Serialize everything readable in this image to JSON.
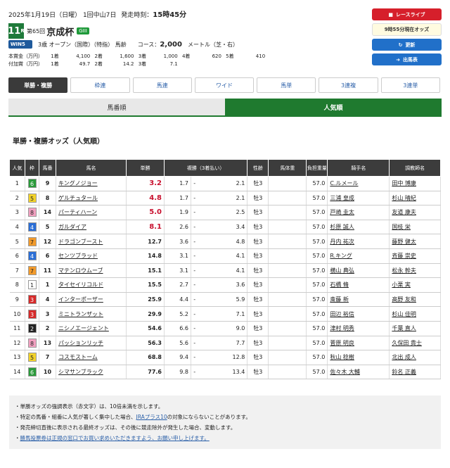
{
  "header": {
    "date": "2025年1月19日（日曜） 1回中山7日",
    "start_label": "発走時刻：",
    "start_time": "15時45分",
    "race_no": "11",
    "race_no_suffix": "R",
    "race_count": "第65回",
    "race_name": "京成杯",
    "grade": "GIII",
    "win5_label": "WIN5",
    "win5_num": "5",
    "conditions": "3歳 オープン（国際）（特指） 馬齢",
    "course_label": "コース：",
    "distance": "2,000",
    "distance_unit": "メートル（芝・右）"
  },
  "prize": {
    "main_label": "本賞金（万円）",
    "main": [
      [
        "1着",
        "4,100"
      ],
      [
        "2着",
        "1,600"
      ],
      [
        "3着",
        "1,000"
      ],
      [
        "4着",
        "620"
      ],
      [
        "5着",
        "410"
      ]
    ],
    "add_label": "付加賞（万円）",
    "add": [
      [
        "1着",
        "49.7"
      ],
      [
        "2着",
        "14.2"
      ],
      [
        "3着",
        "7.1"
      ]
    ]
  },
  "right_buttons": {
    "live": "レースライブ",
    "odds_time": "9時55分現在オッズ",
    "refresh": "更新",
    "entries": "出馬表"
  },
  "tabs": [
    "単勝・複勝",
    "枠連",
    "馬連",
    "ワイド",
    "馬単",
    "3連複",
    "3連単"
  ],
  "sort": {
    "by_number": "馬番順",
    "by_popularity": "人気順"
  },
  "section_title": "単勝・複勝オッズ（人気順）",
  "table": {
    "headers": {
      "rank": "人気",
      "waku": "枠",
      "num": "馬番",
      "horse": "馬名",
      "win": "単勝",
      "place": "複勝（3着払い）",
      "sex_age": "性齢",
      "weight": "馬体重",
      "burden": "負担重量",
      "jockey": "騎手名",
      "trainer": "調教師名"
    },
    "rows": [
      {
        "rank": "1",
        "waku": "6",
        "num": "9",
        "horse": "キングノジョー",
        "win": "3.2",
        "pmin": "1.7",
        "pmax": "2.1",
        "sex": "牡3",
        "weight": "",
        "burden": "57.0",
        "jockey": "C.ルメール",
        "trainer": "田中 博康"
      },
      {
        "rank": "2",
        "waku": "5",
        "num": "8",
        "horse": "ゲルチュタール",
        "win": "4.8",
        "pmin": "1.7",
        "pmax": "2.1",
        "sex": "牡3",
        "weight": "",
        "burden": "57.0",
        "jockey": "三浦 皇成",
        "trainer": "杉山 晴紀"
      },
      {
        "rank": "3",
        "waku": "8",
        "num": "14",
        "horse": "パーティハーン",
        "win": "5.0",
        "pmin": "1.9",
        "pmax": "2.5",
        "sex": "牡3",
        "weight": "",
        "burden": "57.0",
        "jockey": "戸崎 圭太",
        "trainer": "友道 康夫"
      },
      {
        "rank": "4",
        "waku": "4",
        "num": "5",
        "horse": "ガルダイア",
        "win": "8.1",
        "pmin": "2.6",
        "pmax": "3.4",
        "sex": "牡3",
        "weight": "",
        "burden": "57.0",
        "jockey": "杉原 誠人",
        "trainer": "国枝 栄"
      },
      {
        "rank": "5",
        "waku": "7",
        "num": "12",
        "horse": "ドラゴンブースト",
        "win": "12.7",
        "pmin": "3.6",
        "pmax": "4.8",
        "sex": "牡3",
        "weight": "",
        "burden": "57.0",
        "jockey": "丹内 祐次",
        "trainer": "藤野 健太"
      },
      {
        "rank": "6",
        "waku": "4",
        "num": "6",
        "horse": "センツブラッド",
        "win": "14.8",
        "pmin": "3.1",
        "pmax": "4.1",
        "sex": "牡3",
        "weight": "",
        "burden": "57.0",
        "jockey": "R.キング",
        "trainer": "斉藤 崇史"
      },
      {
        "rank": "7",
        "waku": "7",
        "num": "11",
        "horse": "マテンロウムーブ",
        "win": "15.1",
        "pmin": "3.1",
        "pmax": "4.1",
        "sex": "牡3",
        "weight": "",
        "burden": "57.0",
        "jockey": "横山 典弘",
        "trainer": "松永 幹夫"
      },
      {
        "rank": "8",
        "waku": "1",
        "num": "1",
        "horse": "タイセイリコルド",
        "win": "15.5",
        "pmin": "2.7",
        "pmax": "3.6",
        "sex": "牡3",
        "weight": "",
        "burden": "57.0",
        "jockey": "石橋 脩",
        "trainer": "小栗 実"
      },
      {
        "rank": "9",
        "waku": "3",
        "num": "4",
        "horse": "インターポーザー",
        "win": "25.9",
        "pmin": "4.4",
        "pmax": "5.9",
        "sex": "牡3",
        "weight": "",
        "burden": "57.0",
        "jockey": "斎藤 新",
        "trainer": "高野 友和"
      },
      {
        "rank": "10",
        "waku": "3",
        "num": "3",
        "horse": "ミニトランザット",
        "win": "29.9",
        "pmin": "5.2",
        "pmax": "7.1",
        "sex": "牡3",
        "weight": "",
        "burden": "57.0",
        "jockey": "田辺 裕信",
        "trainer": "杉山 佳明"
      },
      {
        "rank": "11",
        "waku": "2",
        "num": "2",
        "horse": "ニシノエージェント",
        "win": "54.6",
        "pmin": "6.6",
        "pmax": "9.0",
        "sex": "牡3",
        "weight": "",
        "burden": "57.0",
        "jockey": "津村 明秀",
        "trainer": "千葉 直人"
      },
      {
        "rank": "12",
        "waku": "8",
        "num": "13",
        "horse": "パッションリッチ",
        "win": "56.3",
        "pmin": "5.6",
        "pmax": "7.7",
        "sex": "牡3",
        "weight": "",
        "burden": "57.0",
        "jockey": "菅原 明良",
        "trainer": "久保田 貴士"
      },
      {
        "rank": "13",
        "waku": "5",
        "num": "7",
        "horse": "コスモストーム",
        "win": "68.8",
        "pmin": "9.4",
        "pmax": "12.8",
        "sex": "牡3",
        "weight": "",
        "burden": "57.0",
        "jockey": "秋山 稔樹",
        "trainer": "北出 成人"
      },
      {
        "rank": "14",
        "waku": "6",
        "num": "10",
        "horse": "シマサンブラック",
        "win": "77.6",
        "pmin": "9.8",
        "pmax": "13.4",
        "sex": "牡3",
        "weight": "",
        "burden": "57.0",
        "jockey": "佐々木 大輔",
        "trainer": "鈴名 正義"
      }
    ]
  },
  "notes": {
    "n1": "・単勝オッズの強調表示（赤文字）は、10倍未満を示します。",
    "n2a": "・特定の馬番・組番に人気が著しく集中した場合、",
    "n2link": "JRAプラス10",
    "n2b": "の対象にならないことがあります。",
    "n3": "・発売締切直後に表示される最終オッズは、その後に競走除外が発生した場合、変動します。",
    "n4a": "・",
    "n4link": "勝馬投票券は正規の窓口でお買い求めいただきますよう、お願い申し上げます。"
  },
  "colors": {
    "waku": {
      "1": "#ffffff",
      "2": "#222222",
      "3": "#d62a2a",
      "4": "#2a6ed6",
      "5": "#f2d22a",
      "6": "#2a9a3a",
      "7": "#f29a2a",
      "8": "#f2a0c0"
    },
    "win_red": "#c8102e",
    "accent_green": "#1f7a2f"
  }
}
